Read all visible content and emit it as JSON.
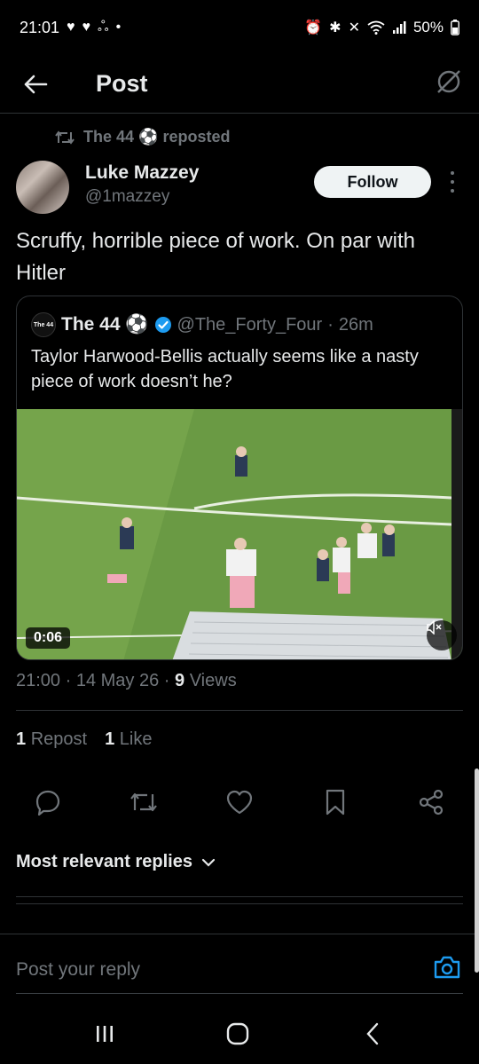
{
  "status_bar": {
    "time": "21:01",
    "battery": "50%"
  },
  "header": {
    "title": "Post"
  },
  "repost": {
    "text": "The 44 ⚽ reposted"
  },
  "post": {
    "author_name": "Luke Mazzey",
    "author_handle": "@1mazzey",
    "follow_label": "Follow",
    "text": "Scruffy, horrible piece of work. On par with Hitler",
    "time": "21:00",
    "date": "14 May 26",
    "views_count": "9",
    "views_label": "Views"
  },
  "quote": {
    "avatar_text": "The 44",
    "name": "The 44 ⚽",
    "handle": "@The_Forty_Four",
    "age": "26m",
    "text": "Taylor Harwood-Bellis actually seems like a nasty piece of work doesn’t he?",
    "video_duration": "0:06"
  },
  "stats": {
    "reposts_count": "1",
    "reposts_label": "Repost",
    "likes_count": "1",
    "likes_label": "Like"
  },
  "replies": {
    "sort_label": "Most relevant replies"
  },
  "reply_bar": {
    "placeholder": "Post your reply"
  },
  "colors": {
    "accent": "#1d9bf0",
    "muted": "#71767b",
    "text": "#e7e9ea",
    "background": "#000000"
  },
  "icons": [
    "arrow-left-icon",
    "grok-icon",
    "retweet-icon",
    "verified-icon",
    "mute-icon",
    "reply-icon",
    "like-icon",
    "bookmark-icon",
    "share-icon",
    "chevron-down-icon",
    "camera-icon"
  ]
}
